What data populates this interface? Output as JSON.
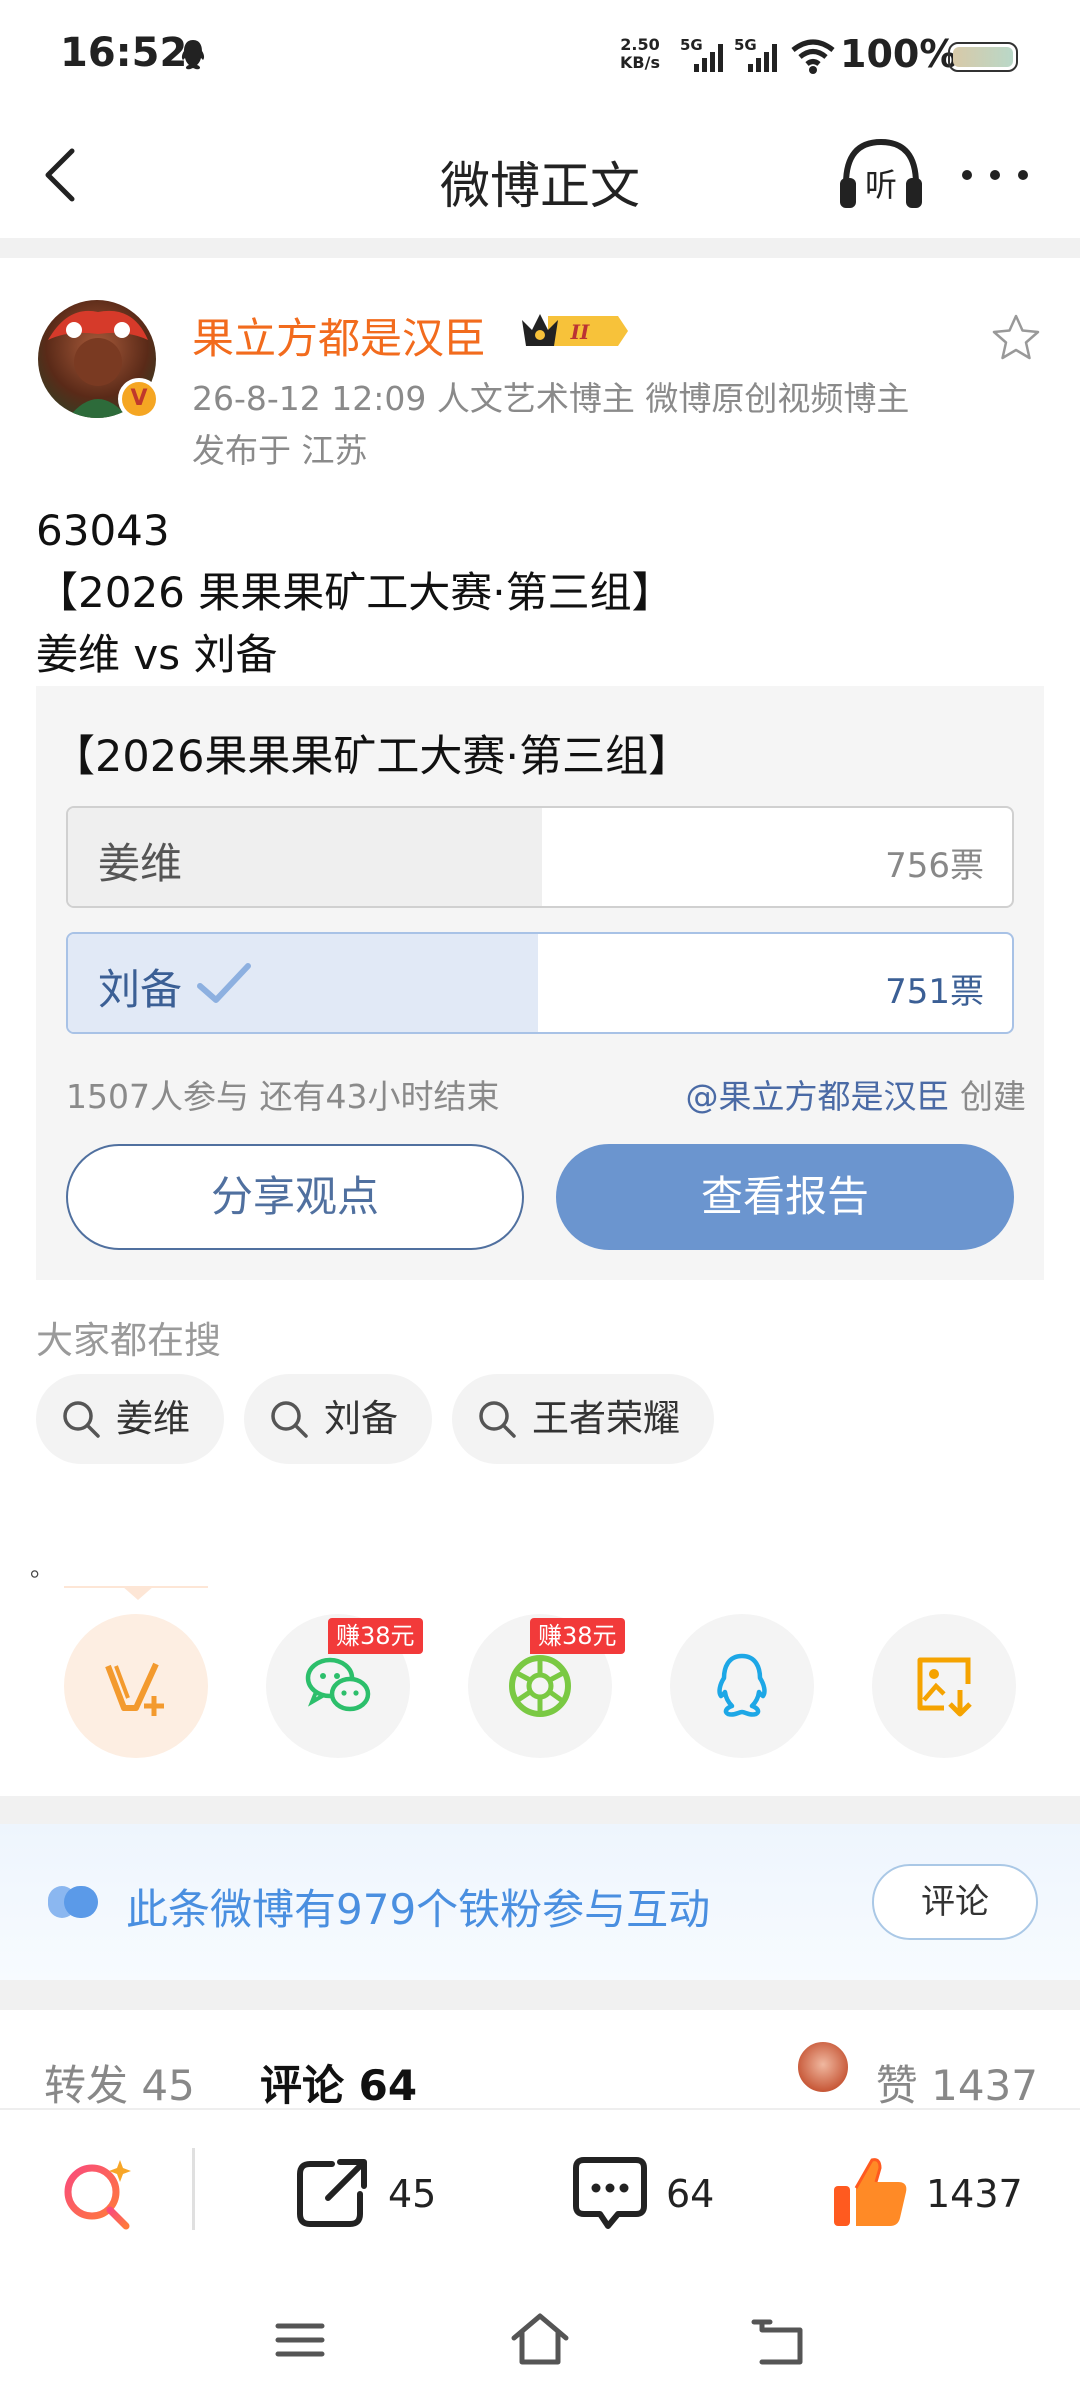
{
  "status_bar": {
    "time": "16:52",
    "net_speed_value": "2.50",
    "net_speed_unit": "KB/s",
    "sim1": "5G",
    "sim2": "5G",
    "battery": "100%"
  },
  "header": {
    "title": "微博正文",
    "listen_label": "听"
  },
  "author": {
    "name": "果立方都是汉臣",
    "badge_level": "II",
    "meta_line": "26-8-12 12:09   人文艺术博主 微博原创视频博主",
    "location_line": "发布于 江苏",
    "verified": "V"
  },
  "post": {
    "text": "63043\n【2026 果果果矿工大赛·第三组】\n姜维 vs 刘备"
  },
  "poll": {
    "title": "【2026果果果矿工大赛·第三组】",
    "options": [
      {
        "label": "姜维",
        "votes": "756票",
        "share": 0.5017
      },
      {
        "label": "刘备",
        "votes": "751票",
        "share": 0.4983,
        "selected": true
      }
    ],
    "stats": "1507人参与  还有43小时结束",
    "creator_name": "@果立方都是汉臣",
    "creator_suffix": " 创建",
    "share_label": "分享观点",
    "report_label": "查看报告"
  },
  "trending": {
    "label": "大家都在搜",
    "chips": [
      "姜维",
      "刘备",
      "王者荣耀"
    ]
  },
  "tiny_mark": "。",
  "share_row": {
    "earn_tag_wechat": "赚38元",
    "earn_tag_moments": "赚38元",
    "icons": [
      "weibo-v-plus-icon",
      "wechat-icon",
      "moments-icon",
      "qq-icon",
      "save-image-icon"
    ]
  },
  "fans_banner": {
    "text": "此条微博有979个铁粉参与互动",
    "button": "评论"
  },
  "tabs": {
    "repost": "转发 45",
    "comment": "评论 64",
    "likes": "赞 1437"
  },
  "actions": {
    "repost_count": "45",
    "comment_count": "64",
    "like_count": "1437"
  },
  "colors": {
    "author_name": "#f26b1d",
    "poll_accent": "#6b95cf",
    "fans_text": "#4a8fe0",
    "earn_tag": "#f23a3a"
  }
}
